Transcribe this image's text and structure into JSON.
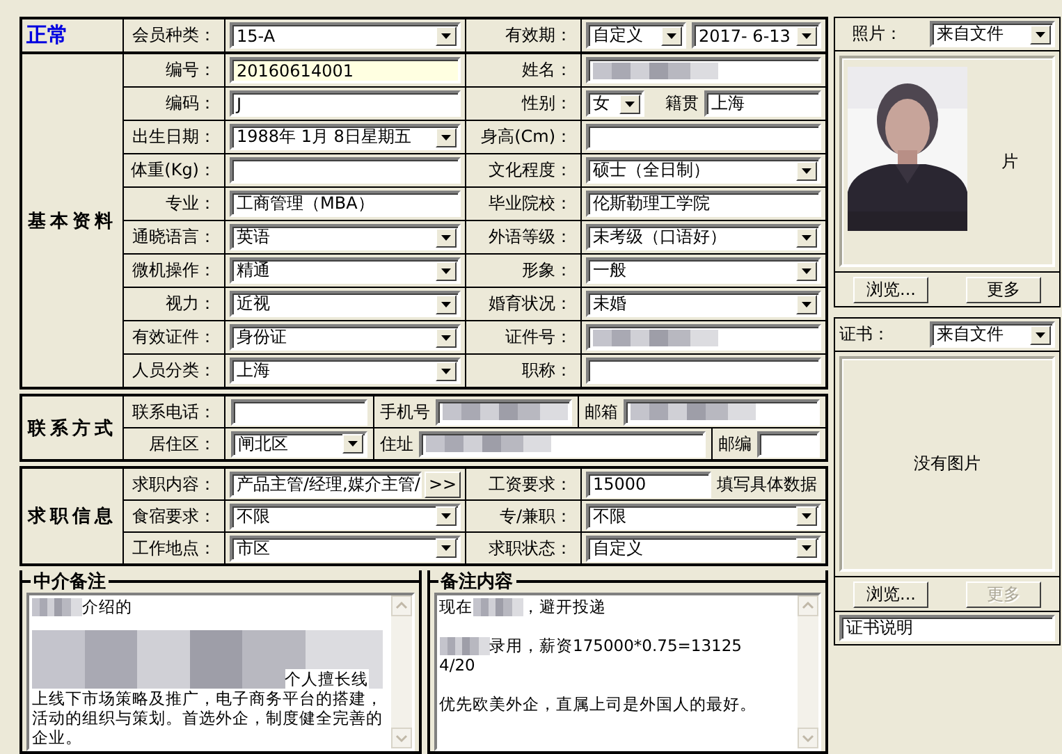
{
  "header": {
    "status": "正常",
    "member_type": {
      "label": "会员种类：",
      "value": "15-A"
    },
    "validity": {
      "label": "有效期：",
      "mode": "自定义",
      "date": "2017- 6-13"
    }
  },
  "basic": {
    "title": "基本资料",
    "left": [
      {
        "label": "编号：",
        "kind": "text",
        "value": "20160614001",
        "highlighted": true
      },
      {
        "label": "编码：",
        "kind": "text",
        "value": "J"
      },
      {
        "label": "出生日期：",
        "kind": "combo",
        "value": "1988年 1月 8日星期五"
      },
      {
        "label": "体重(Kg)：",
        "kind": "text"
      },
      {
        "label": "专业：",
        "kind": "text",
        "value": "工商管理（MBA）"
      },
      {
        "label": "通晓语言：",
        "kind": "combo",
        "value": "英语"
      },
      {
        "label": "微机操作：",
        "kind": "combo",
        "value": "精通"
      },
      {
        "label": "视力：",
        "kind": "combo",
        "value": "近视"
      },
      {
        "label": "有效证件：",
        "kind": "combo",
        "value": "身份证"
      },
      {
        "label": "人员分类：",
        "kind": "combo",
        "value": "上海"
      }
    ],
    "right": [
      {
        "label": "姓名：",
        "kind": "text",
        "redacted": true
      },
      {
        "label": "性别：",
        "kind": "gender",
        "value": "女",
        "origin_label": "籍贯",
        "origin": "上海"
      },
      {
        "label": "身高(Cm)：",
        "kind": "text"
      },
      {
        "label": "文化程度：",
        "kind": "combo",
        "value": "硕士（全日制）"
      },
      {
        "label": "毕业院校：",
        "kind": "text",
        "value": "伦斯勒理工学院"
      },
      {
        "label": "外语等级：",
        "kind": "combo",
        "value": "未考级（口语好）"
      },
      {
        "label": "形象：",
        "kind": "combo",
        "value": "一般"
      },
      {
        "label": "婚育状况：",
        "kind": "combo",
        "value": "未婚"
      },
      {
        "label": "证件号：",
        "kind": "text",
        "redacted": true
      },
      {
        "label": "职称：",
        "kind": "text"
      }
    ]
  },
  "contact": {
    "title": "联系方式",
    "phone": {
      "label": "联系电话："
    },
    "mobile": {
      "label": "手机号",
      "redacted": true
    },
    "email": {
      "label": "邮箱",
      "redacted": true
    },
    "district": {
      "label": "居住区：",
      "value": "闸北区"
    },
    "address": {
      "label": "住址",
      "redacted": true
    },
    "postcode": {
      "label": "邮编"
    }
  },
  "job": {
    "title": "求职信息",
    "content": {
      "label": "求职内容：",
      "value": "产品主管/经理,媒介主管/",
      "button": ">>"
    },
    "salary": {
      "label": "工资要求：",
      "value": "15000",
      "hint": "填写具体数据"
    },
    "board": {
      "label": "食宿要求：",
      "value": "不限"
    },
    "work_type": {
      "label": "专/兼职：",
      "value": "不限"
    },
    "location": {
      "label": "工作地点：",
      "value": "市区"
    },
    "status": {
      "label": "求职状态：",
      "value": "自定义"
    }
  },
  "notes": [
    {
      "title": "中介备注",
      "lines": [
        {
          "kind": "parts",
          "parts": [
            {
              "kind": "redacted"
            },
            {
              "kind": "text",
              "text": "介绍的"
            }
          ]
        },
        {
          "kind": "blank"
        },
        {
          "kind": "block",
          "tail": "个人擅长线"
        },
        {
          "kind": "parts",
          "parts": [
            {
              "kind": "text",
              "text": "上线下市场策略及推广，电子商务平台的搭建，"
            }
          ]
        },
        {
          "kind": "parts",
          "parts": [
            {
              "kind": "text",
              "text": "活动的组织与策划。首选外企，制度健全完善的"
            }
          ]
        },
        {
          "kind": "parts",
          "parts": [
            {
              "kind": "text",
              "text": "企业。"
            }
          ]
        }
      ]
    },
    {
      "title": "备注内容",
      "lines": [
        {
          "kind": "parts",
          "parts": [
            {
              "kind": "text",
              "text": "现在"
            },
            {
              "kind": "redacted"
            },
            {
              "kind": "text",
              "text": "，避开投递"
            }
          ]
        },
        {
          "kind": "blank"
        },
        {
          "kind": "parts",
          "parts": [
            {
              "kind": "redacted"
            },
            {
              "kind": "text",
              "text": "录用，薪资175000*0.75=13125"
            }
          ]
        },
        {
          "kind": "parts",
          "parts": [
            {
              "kind": "text",
              "text": "4/20"
            }
          ]
        },
        {
          "kind": "blank"
        },
        {
          "kind": "parts",
          "parts": [
            {
              "kind": "text",
              "text": "优先欧美外企，直属上司是外国人的最好。"
            }
          ]
        }
      ]
    }
  ],
  "photo": {
    "label": "照片：",
    "source": "来自文件",
    "kind": "picture",
    "behind_text": "片",
    "browse": {
      "label": "浏览...",
      "disabled": false
    },
    "more": {
      "label": "更多",
      "disabled": false
    }
  },
  "certificate": {
    "label": "证书：",
    "source": "来自文件",
    "empty_text": "没有图片",
    "browse": {
      "label": "浏览...",
      "disabled": false
    },
    "more": {
      "label": "更多",
      "disabled": true
    },
    "caption": "证书说明"
  }
}
